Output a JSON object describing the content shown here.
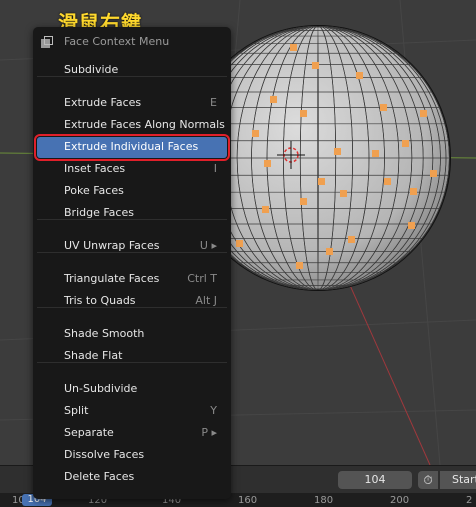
{
  "caption": "滑鼠右鍵",
  "menu": {
    "title": "Face Context Menu",
    "groups": [
      [
        {
          "label": "Subdivide",
          "shortcut": ""
        }
      ],
      [
        {
          "label": "Extrude Faces",
          "shortcut": "E"
        },
        {
          "label": "Extrude Faces Along Normals",
          "shortcut": ""
        },
        {
          "label": "Extrude Individual Faces",
          "shortcut": "",
          "highlighted": true
        },
        {
          "label": "Inset Faces",
          "shortcut": "I"
        },
        {
          "label": "Poke Faces",
          "shortcut": ""
        },
        {
          "label": "Bridge Faces",
          "shortcut": ""
        }
      ],
      [
        {
          "label": "UV Unwrap Faces",
          "shortcut": "U ▸"
        }
      ],
      [
        {
          "label": "Triangulate Faces",
          "shortcut": "Ctrl T"
        },
        {
          "label": "Tris to Quads",
          "shortcut": "Alt J"
        }
      ],
      [
        {
          "label": "Shade Smooth",
          "shortcut": ""
        },
        {
          "label": "Shade Flat",
          "shortcut": ""
        }
      ],
      [
        {
          "label": "Un-Subdivide",
          "shortcut": ""
        },
        {
          "label": "Split",
          "shortcut": "Y"
        },
        {
          "label": "Separate",
          "shortcut": "P ▸"
        },
        {
          "label": "Dissolve Faces",
          "shortcut": ""
        },
        {
          "label": "Delete Faces",
          "shortcut": ""
        }
      ]
    ]
  },
  "timeline": {
    "current_frame": "104",
    "frame_field": "104",
    "start_label": "Start",
    "ruler_ticks": [
      "10",
      "120",
      "140",
      "160",
      "180",
      "200",
      "2"
    ]
  },
  "colors": {
    "accent": "#4772b3",
    "highlight_border": "#e0202a",
    "caption": "#ffd92e",
    "face_selected": "#f0a050"
  }
}
